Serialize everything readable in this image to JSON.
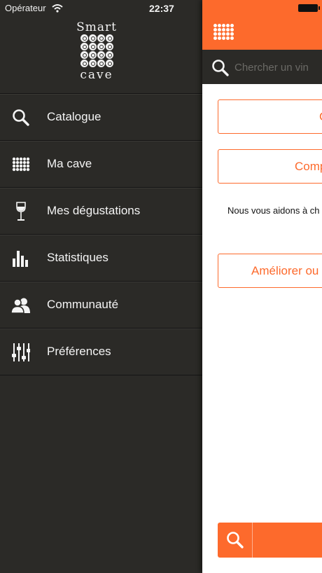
{
  "status": {
    "carrier": "Opérateur",
    "time": "22:37"
  },
  "logo": {
    "top": "Smart",
    "bottom": "cave"
  },
  "menu": {
    "items": [
      {
        "label": "Catalogue",
        "icon": "search-icon"
      },
      {
        "label": "Ma cave",
        "icon": "cellar-grid-icon"
      },
      {
        "label": "Mes dégustations",
        "icon": "wine-glass-icon"
      },
      {
        "label": "Statistiques",
        "icon": "bar-chart-icon"
      },
      {
        "label": "Communauté",
        "icon": "users-icon"
      },
      {
        "label": "Préférences",
        "icon": "sliders-icon"
      }
    ]
  },
  "main": {
    "search_placeholder": "Chercher un vin",
    "buttons": {
      "first": "C",
      "second": "Comp",
      "third": "Améliorer ou"
    },
    "help_text": "Nous vous aidons à ch"
  },
  "colors": {
    "accent": "#fd6a2c",
    "drawer_bg": "#2b2a27",
    "text_light": "#f4f4f4"
  }
}
